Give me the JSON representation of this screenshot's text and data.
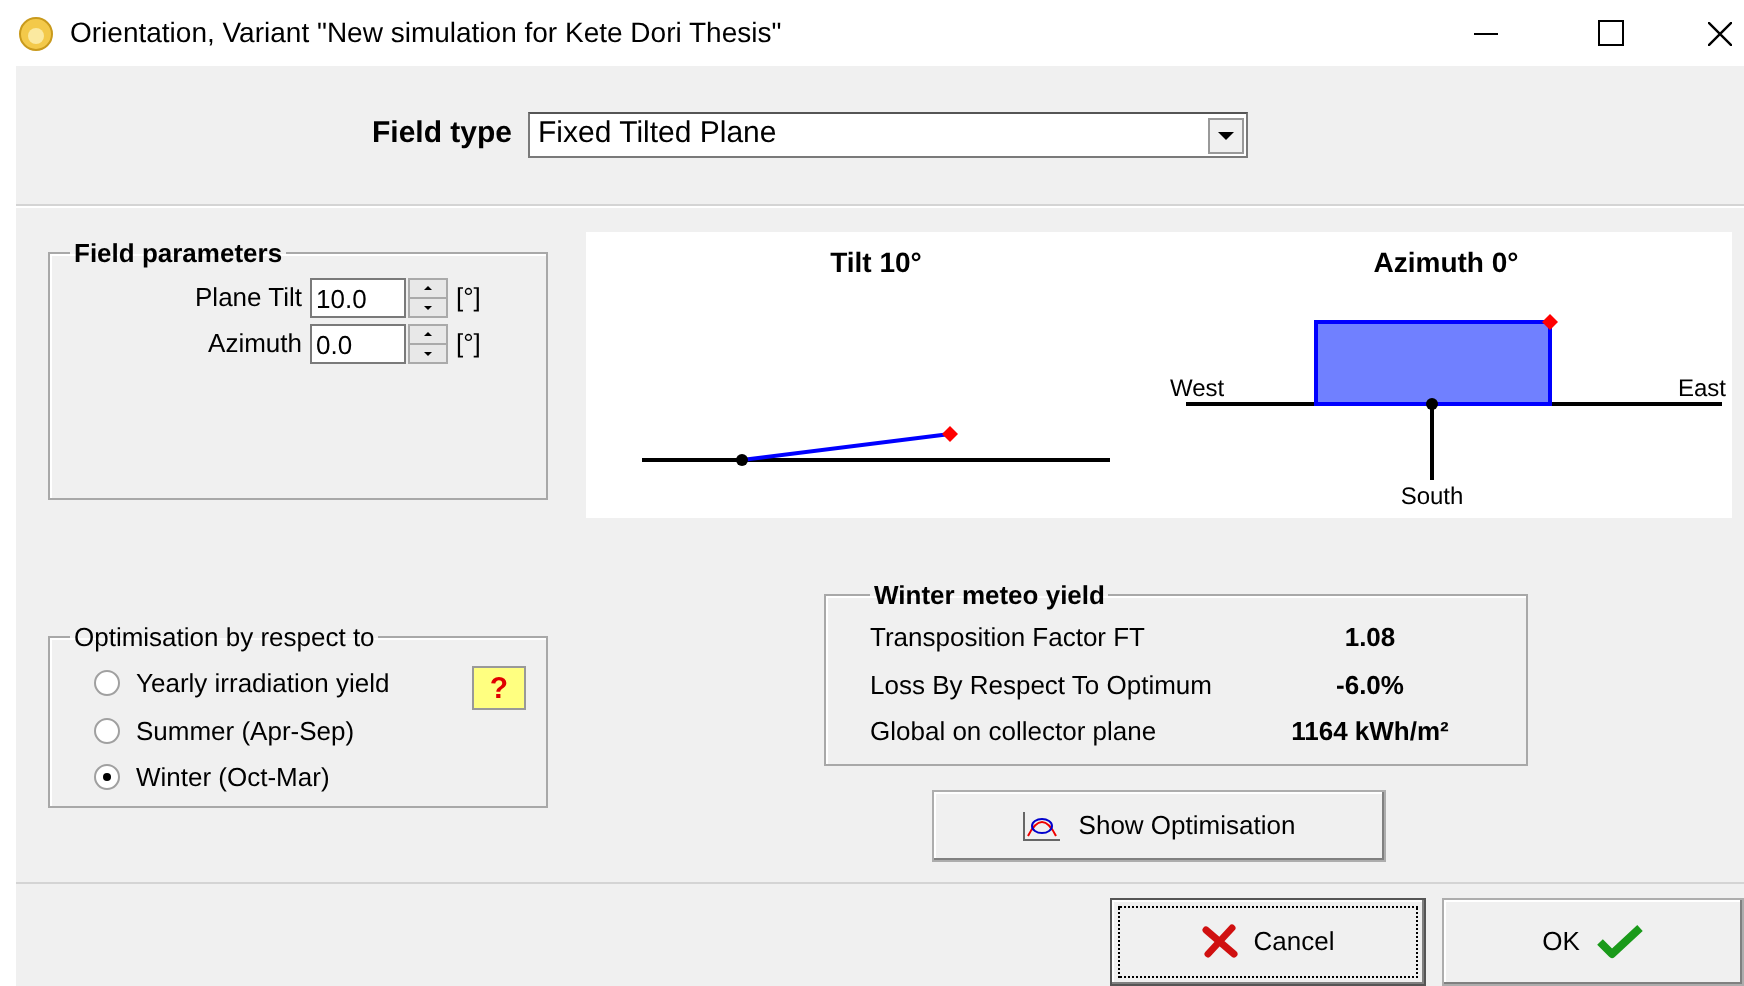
{
  "window": {
    "title": "Orientation, Variant \"New simulation for Kete Dori Thesis\""
  },
  "field_type": {
    "label": "Field type",
    "value": "Fixed Tilted Plane"
  },
  "field_parameters": {
    "title": "Field parameters",
    "rows": [
      {
        "label": "Plane Tilt",
        "value": "10.0",
        "unit": "[°]"
      },
      {
        "label": "Azimuth",
        "value": "0.0",
        "unit": "[°]"
      }
    ]
  },
  "diagram": {
    "tilt_title": "Tilt 10°",
    "azimuth_title": "Azimuth 0°",
    "west": "West",
    "east": "East",
    "south": "South"
  },
  "optimisation": {
    "title": "Optimisation by respect to",
    "help": "?",
    "options": [
      {
        "label": "Yearly irradiation yield",
        "selected": false
      },
      {
        "label": "Summer (Apr-Sep)",
        "selected": false
      },
      {
        "label": "Winter (Oct-Mar)",
        "selected": true
      }
    ]
  },
  "meteo_yield": {
    "title": "Winter meteo yield",
    "rows": [
      {
        "label": "Transposition Factor FT",
        "value": "1.08"
      },
      {
        "label": "Loss By Respect To Optimum",
        "value": "-6.0%"
      },
      {
        "label": "Global on collector plane",
        "value": "1164 kWh/m²"
      }
    ]
  },
  "show_optimisation": {
    "label": "Show Optimisation"
  },
  "buttons": [
    {
      "kind": "cancel",
      "label": "Cancel",
      "focused": true
    },
    {
      "kind": "ok",
      "label": "OK",
      "focused": false
    }
  ]
}
